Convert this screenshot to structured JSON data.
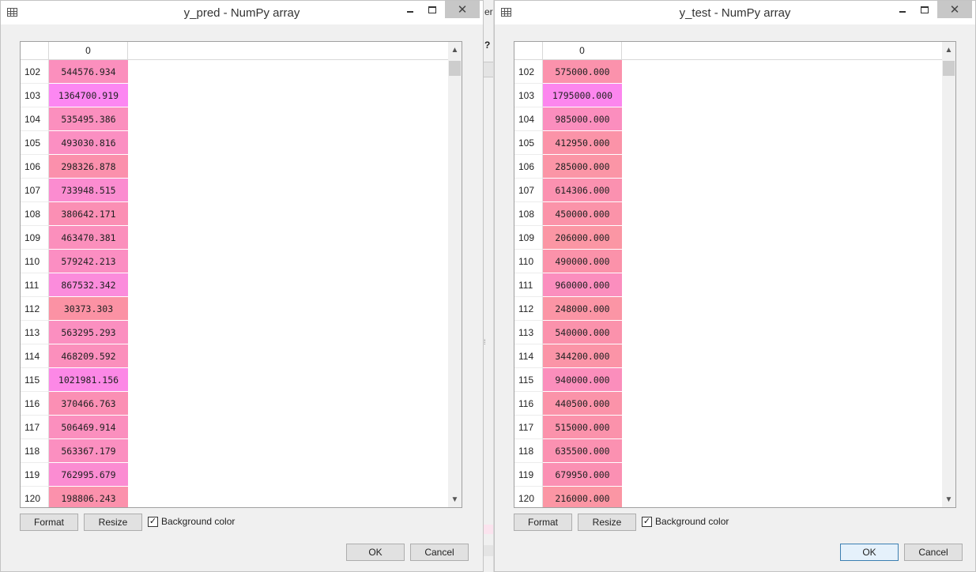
{
  "gap": {
    "fragment_top": "er",
    "fragment_mid": "?",
    "splitter_glyph": "⁞"
  },
  "windows": [
    {
      "title": "y_pred - NumPy array",
      "column_header": "0",
      "rows": [
        {
          "index": "102",
          "value": "544576.934",
          "color": "#fb8fbd"
        },
        {
          "index": "103",
          "value": "1364700.919",
          "color": "#fc87f2"
        },
        {
          "index": "104",
          "value": "535495.386",
          "color": "#fb8fbe"
        },
        {
          "index": "105",
          "value": "493030.816",
          "color": "#fb8fc2"
        },
        {
          "index": "106",
          "value": "298326.878",
          "color": "#fb90ac"
        },
        {
          "index": "107",
          "value": "733948.515",
          "color": "#fb8cd0"
        },
        {
          "index": "108",
          "value": "380642.171",
          "color": "#fb8fb4"
        },
        {
          "index": "109",
          "value": "463470.381",
          "color": "#fb8fbc"
        },
        {
          "index": "110",
          "value": "579242.213",
          "color": "#fb8ec2"
        },
        {
          "index": "111",
          "value": "867532.342",
          "color": "#fb8cdc"
        },
        {
          "index": "112",
          "value": "30373.303",
          "color": "#fb92a4"
        },
        {
          "index": "113",
          "value": "563295.293",
          "color": "#fb8fc0"
        },
        {
          "index": "114",
          "value": "468209.592",
          "color": "#fb8fbc"
        },
        {
          "index": "115",
          "value": "1021981.156",
          "color": "#fc88e6"
        },
        {
          "index": "116",
          "value": "370466.763",
          "color": "#fb8fb4"
        },
        {
          "index": "117",
          "value": "506469.914",
          "color": "#fb8fbe"
        },
        {
          "index": "118",
          "value": "563367.179",
          "color": "#fb8fc0"
        },
        {
          "index": "119",
          "value": "762995.679",
          "color": "#fb8cd2"
        },
        {
          "index": "120",
          "value": "198806.243",
          "color": "#fb91ac"
        }
      ],
      "buttons": {
        "format": "Format",
        "resize": "Resize",
        "ok": "OK",
        "cancel": "Cancel"
      },
      "checkbox_label": "Background color",
      "checkbox_mark": "✓"
    },
    {
      "title": "y_test - NumPy array",
      "column_header": "0",
      "rows": [
        {
          "index": "102",
          "value": "575000.000",
          "color": "#fb92ac"
        },
        {
          "index": "103",
          "value": "1795000.000",
          "color": "#fc86ee"
        },
        {
          "index": "104",
          "value": "985000.000",
          "color": "#fb8ebe"
        },
        {
          "index": "105",
          "value": "412950.000",
          "color": "#fb93a8"
        },
        {
          "index": "106",
          "value": "285000.000",
          "color": "#fb95a6"
        },
        {
          "index": "107",
          "value": "614306.000",
          "color": "#fb91b0"
        },
        {
          "index": "108",
          "value": "450000.000",
          "color": "#fb93a9"
        },
        {
          "index": "109",
          "value": "206000.000",
          "color": "#fb96a4"
        },
        {
          "index": "110",
          "value": "490000.000",
          "color": "#fb92aa"
        },
        {
          "index": "111",
          "value": "960000.000",
          "color": "#fb8ebe"
        },
        {
          "index": "112",
          "value": "248000.000",
          "color": "#fb95a5"
        },
        {
          "index": "113",
          "value": "540000.000",
          "color": "#fb92ac"
        },
        {
          "index": "114",
          "value": "344200.000",
          "color": "#fb94a7"
        },
        {
          "index": "115",
          "value": "940000.000",
          "color": "#fb8ebc"
        },
        {
          "index": "116",
          "value": "440500.000",
          "color": "#fb93a9"
        },
        {
          "index": "117",
          "value": "515000.000",
          "color": "#fb92ab"
        },
        {
          "index": "118",
          "value": "635500.000",
          "color": "#fb91b1"
        },
        {
          "index": "119",
          "value": "679950.000",
          "color": "#fb90b3"
        },
        {
          "index": "120",
          "value": "216000.000",
          "color": "#fb96a4"
        }
      ],
      "buttons": {
        "format": "Format",
        "resize": "Resize",
        "ok": "OK",
        "cancel": "Cancel"
      },
      "checkbox_label": "Background color",
      "checkbox_mark": "✓"
    }
  ]
}
